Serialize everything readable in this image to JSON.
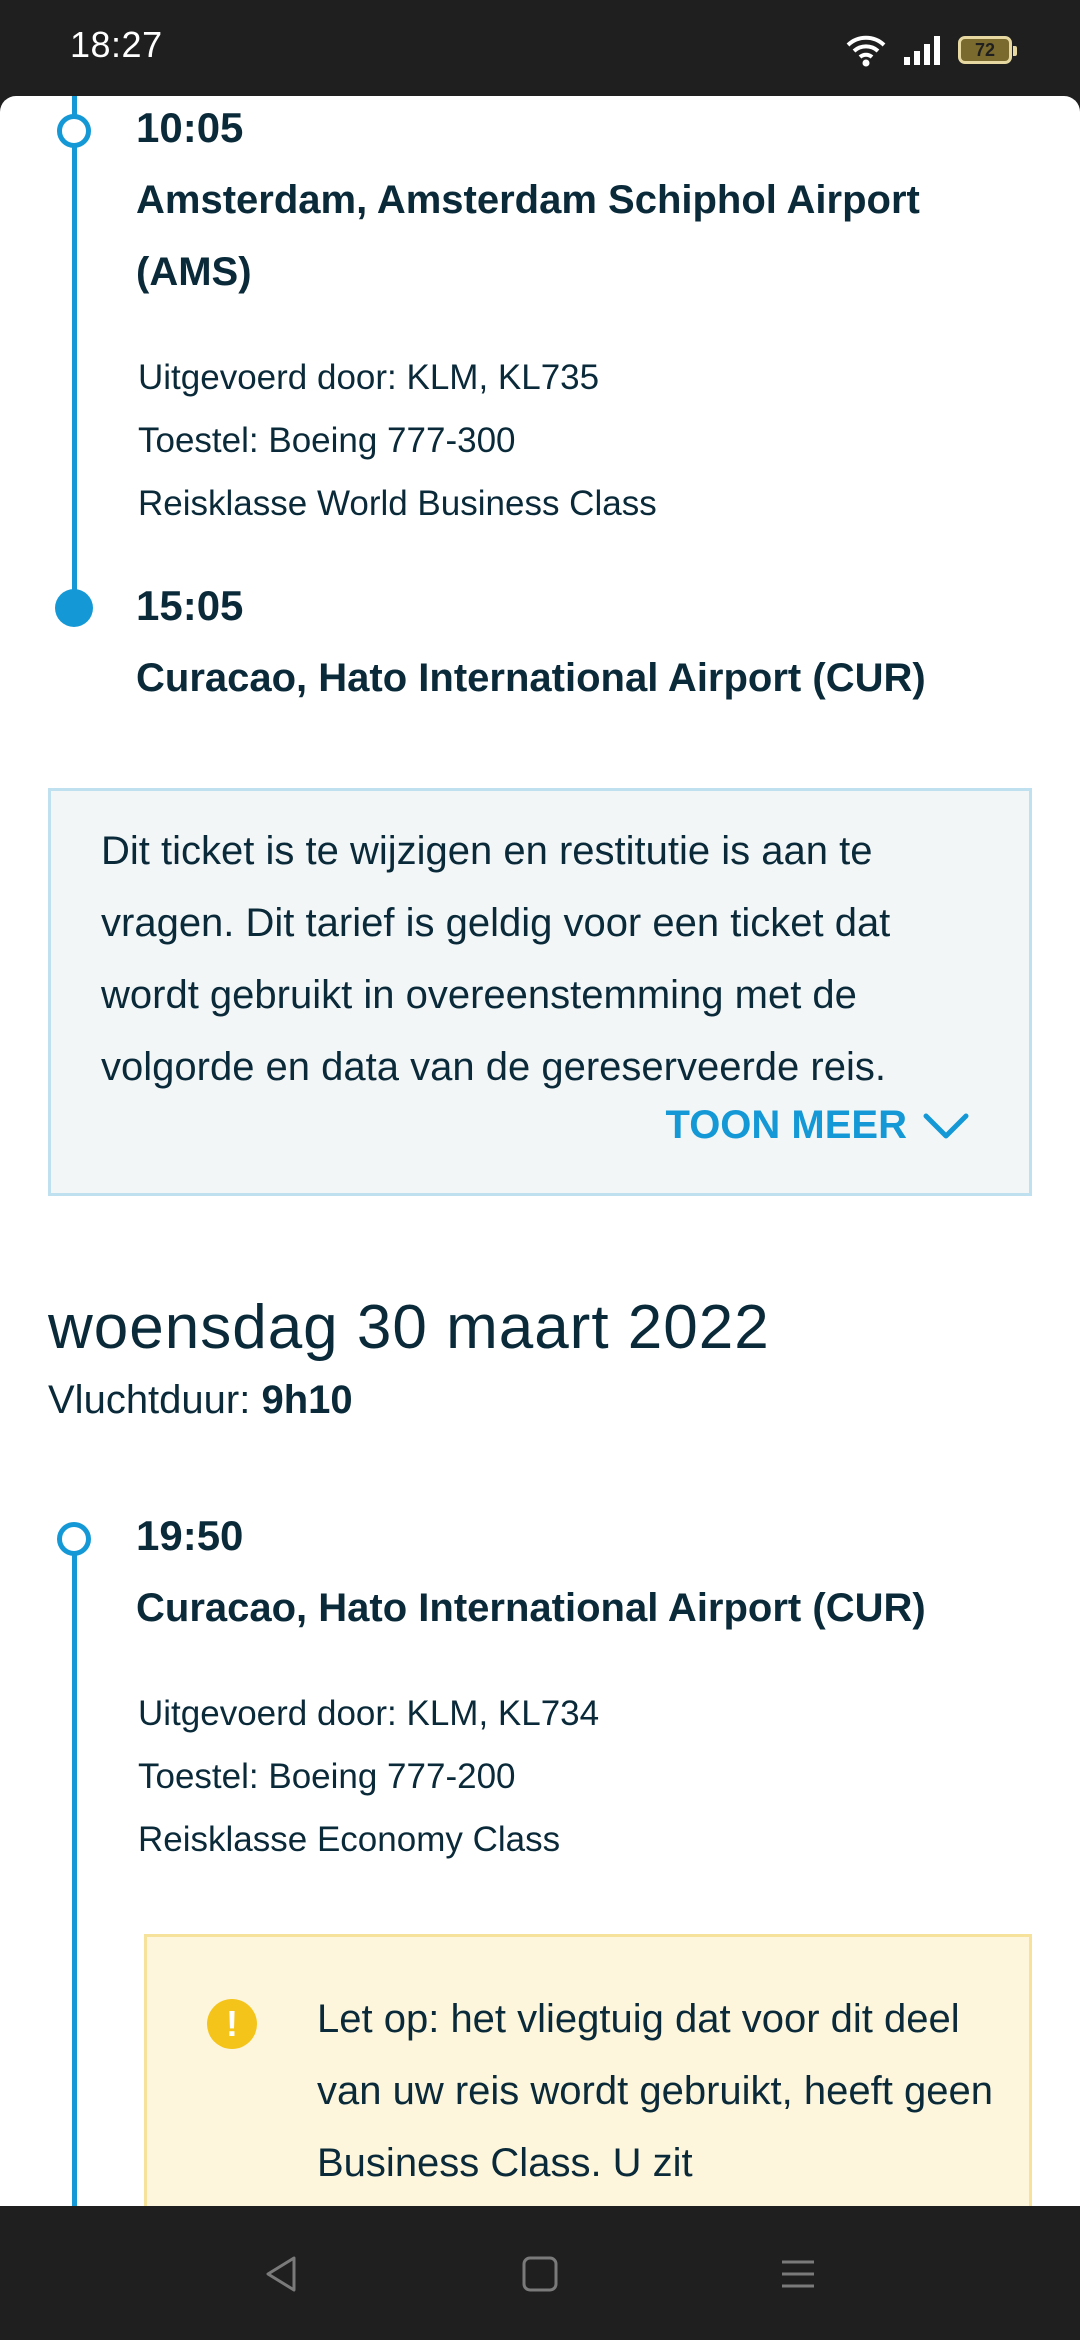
{
  "status_bar": {
    "time": "18:27",
    "battery": "72"
  },
  "segment1": {
    "departure_time": "10:05",
    "departure_airport": "Amsterdam, Amsterdam Schiphol Airport (AMS)",
    "operated_by": "Uitgevoerd door: KLM, KL735",
    "aircraft": "Toestel: Boeing 777-300",
    "travel_class": "Reisklasse World Business Class",
    "arrival_time": "15:05",
    "arrival_airport": "Curacao, Hato International Airport (CUR)"
  },
  "info_box": {
    "text": "Dit ticket is te wijzigen en restitutie is aan te vragen. Dit tarief is geldig voor een ticket dat wordt gebruikt in overeenstemming met de volgorde en data van de gereserveerde reis.",
    "toggle_label": "TOON MEER"
  },
  "return_day": {
    "date": "woensdag 30 maart 2022",
    "duration_label": "Vluchtduur:",
    "duration_value": "9h10"
  },
  "segment2": {
    "departure_time": "19:50",
    "departure_airport": "Curacao, Hato International Airport (CUR)",
    "operated_by": "Uitgevoerd door: KLM, KL734",
    "aircraft": "Toestel: Boeing 777-200",
    "travel_class": "Reisklasse Economy Class"
  },
  "warning": {
    "icon_glyph": "!",
    "text": "Let op: het vliegtuig dat voor dit deel van uw reis wordt gebruikt, heeft geen Business Class. U zit"
  },
  "colors": {
    "accent": "#1599d6",
    "text": "#0a2a3a",
    "warning": "#f4c41b"
  },
  "icons": [
    "wifi-icon",
    "signal-icon",
    "battery-icon",
    "chevron-down-icon",
    "warning-icon",
    "back-icon",
    "home-icon",
    "menu-icon"
  ]
}
